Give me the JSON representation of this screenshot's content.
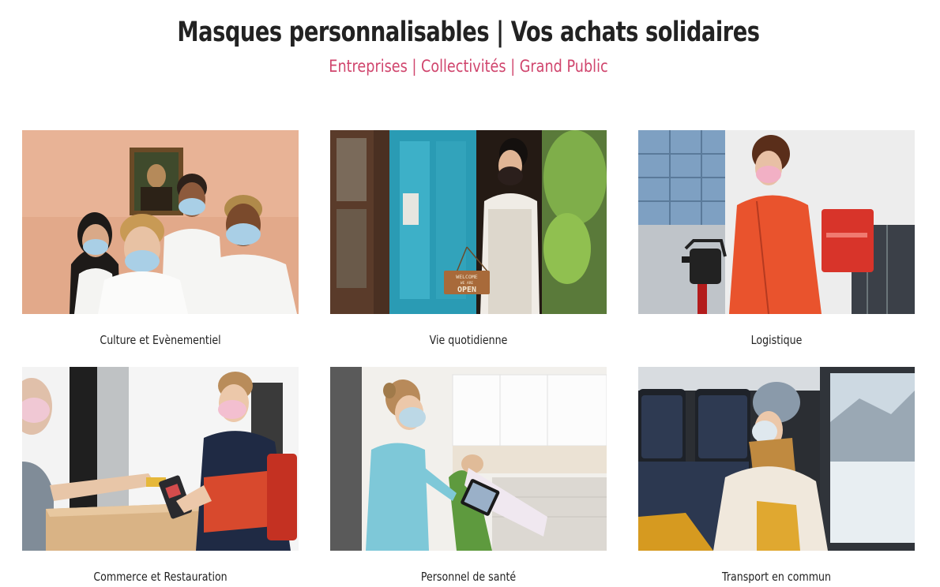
{
  "header": {
    "title": "Masques personnalisables | Vos achats solidaires",
    "subtitle": "Entreprises | Collectivités | Grand Public"
  },
  "categories": [
    {
      "label": "Culture et Evènementiel"
    },
    {
      "label": "Vie quotidienne",
      "sign_line_1": "WELCOME",
      "sign_line_2": "WE ARE",
      "sign_line_3": "OPEN"
    },
    {
      "label": "Logistique"
    },
    {
      "label": "Commerce et Restauration"
    },
    {
      "label": "Personnel de santé"
    },
    {
      "label": "Transport en commun"
    }
  ],
  "colors": {
    "title": "#222222",
    "accent": "#d0456d",
    "background": "#ffffff"
  }
}
